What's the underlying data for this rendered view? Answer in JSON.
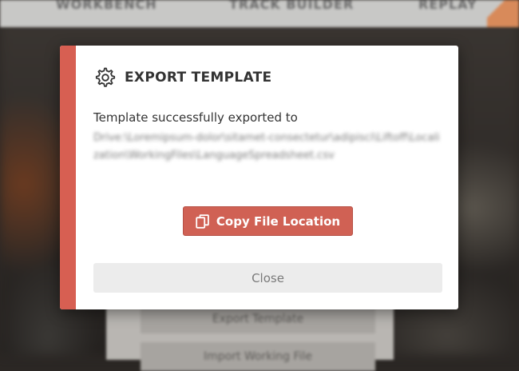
{
  "background": {
    "nav": {
      "workbench": "WORKBENCH",
      "track_builder": "TRACK BUILDER",
      "replay": "REPLAY"
    },
    "panel": {
      "export_template": "Export Template",
      "import_file": "Import Working File"
    }
  },
  "modal": {
    "title": "EXPORT TEMPLATE",
    "title_icon": "gear-icon",
    "message": "Template successfully exported to",
    "path": "Drive:\\Loremipsum-dolor\\sitamet-consectetur\\adipisci\\Liftoff\\Localization\\WorkingFiles\\LanguageSpreadsheet.csv",
    "copy_button_label": "Copy File Location",
    "copy_button_icon": "copy-icon",
    "close_button_label": "Close"
  },
  "colors": {
    "accent": "#d75f52",
    "button": "#d06154",
    "close_button_bg": "#ececec"
  }
}
